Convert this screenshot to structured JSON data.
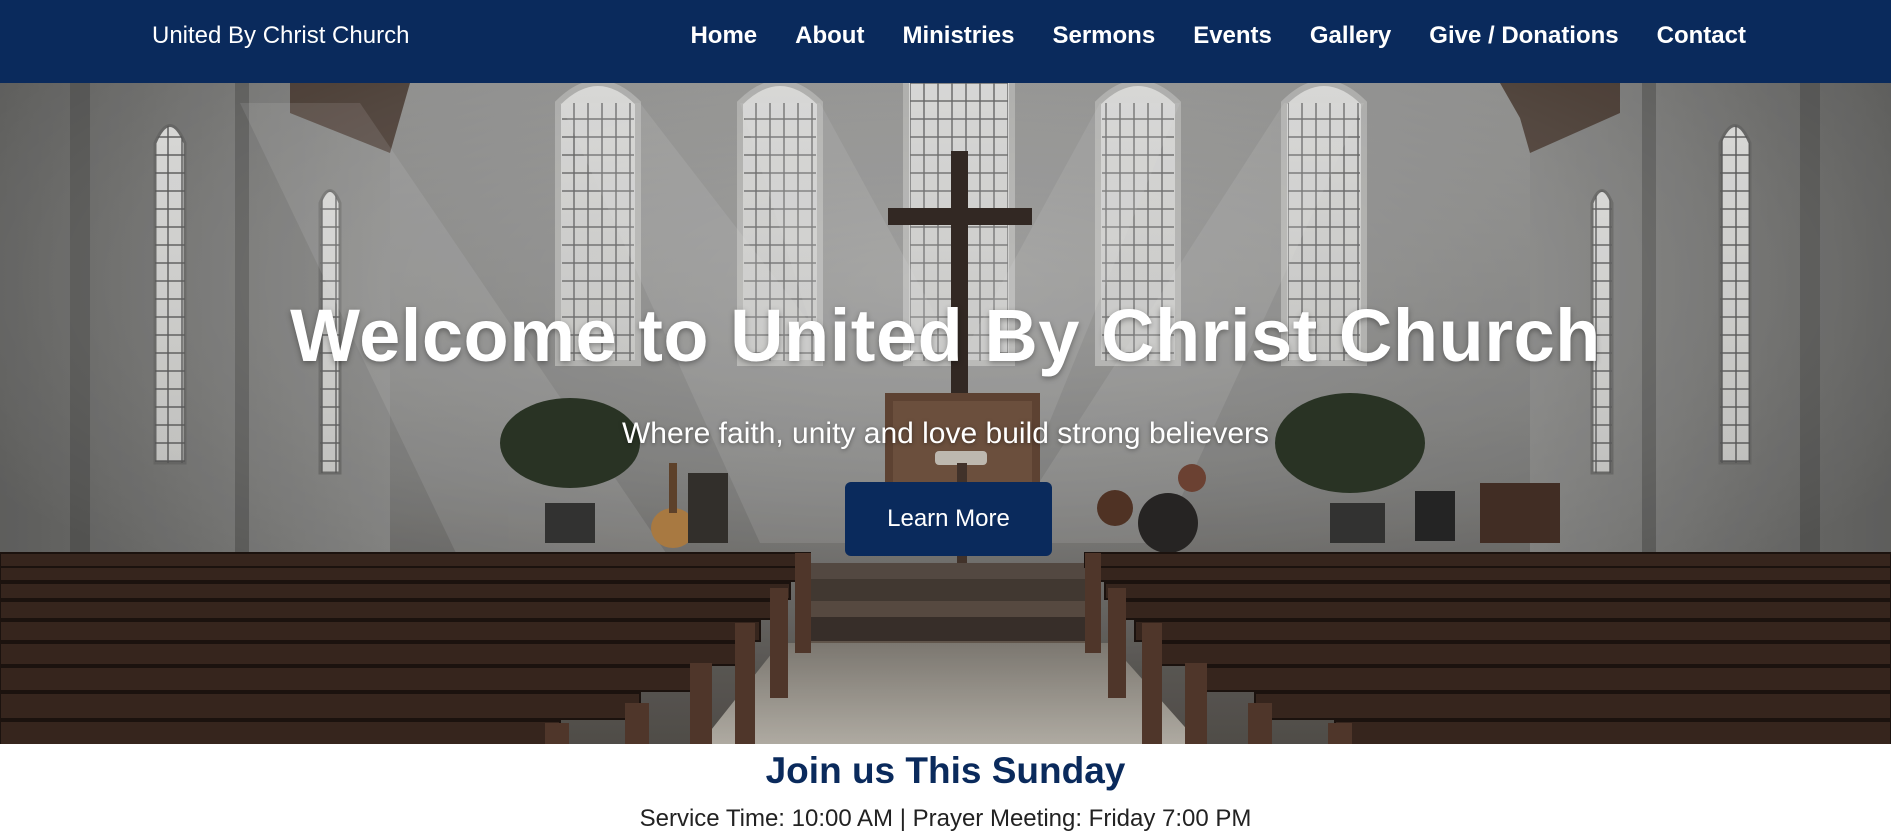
{
  "navbar": {
    "brand": "United By Christ Church",
    "links": [
      "Home",
      "About",
      "Ministries",
      "Sermons",
      "Events",
      "Gallery",
      "Give / Donations",
      "Contact"
    ]
  },
  "hero": {
    "title": "Welcome to United By Christ Church",
    "subtitle": "Where faith, unity and love build strong believers",
    "button_label": "Learn More",
    "background_image": "church-interior-photo"
  },
  "service_section": {
    "title": "Join us This Sunday",
    "info": "Service Time: 10:00 AM | Prayer Meeting: Friday 7:00 PM"
  },
  "colors": {
    "navy": "#0a2a5c",
    "white": "#ffffff"
  }
}
